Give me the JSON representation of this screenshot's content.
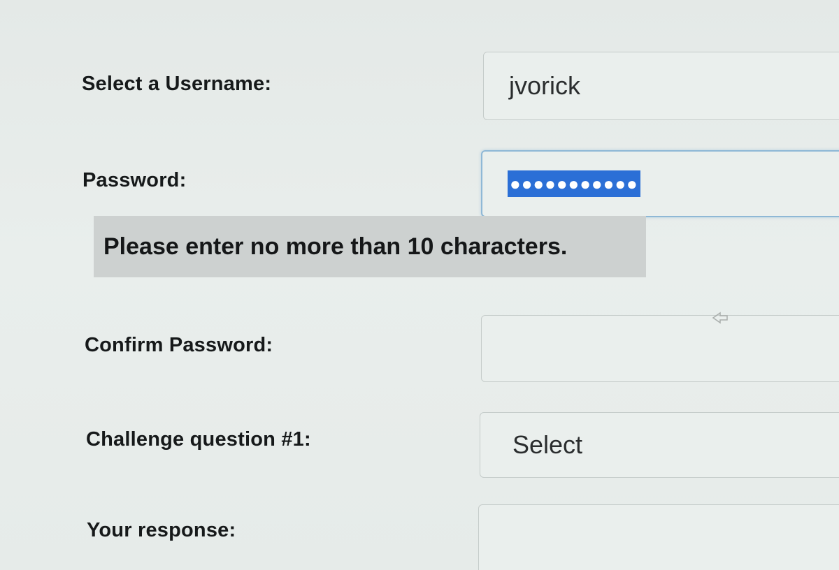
{
  "form": {
    "username": {
      "label": "Select a Username:",
      "value": "jvorick"
    },
    "password": {
      "label": "Password:",
      "masked_value": "●●●●●●●●●●●",
      "selected": true,
      "focused": true
    },
    "validation_tooltip": "Please enter no more than 10 characters.",
    "confirm_password": {
      "label": "Confirm Password:",
      "value": ""
    },
    "challenge_question": {
      "label": "Challenge question #1:",
      "selected_option": "Select"
    },
    "response": {
      "label": "Your response:",
      "value": ""
    }
  },
  "colors": {
    "selection_highlight": "#2b6fd6",
    "focus_border": "#8fb8d6",
    "tooltip_background": "#cdd1d0"
  },
  "icons": {
    "cursor": "mouse-pointer-icon"
  }
}
